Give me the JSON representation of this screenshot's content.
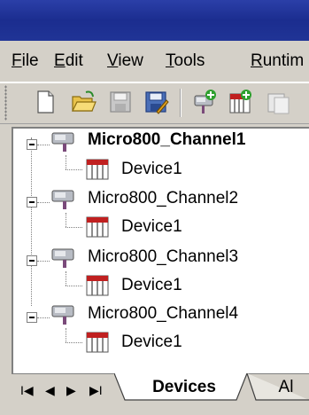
{
  "menu": {
    "file": {
      "u": "F",
      "rest": "ile"
    },
    "edit": {
      "u": "E",
      "rest": "dit"
    },
    "view": {
      "u": "V",
      "rest": "iew"
    },
    "tools": {
      "u": "T",
      "rest": "ools"
    },
    "runtime": {
      "u": "R",
      "rest": "untim"
    }
  },
  "toolbar": {
    "buttons": [
      "new-file-icon",
      "open-folder-icon",
      "save-icon",
      "save-as-icon",
      "new-channel-icon",
      "new-device-icon",
      "cut-icon"
    ]
  },
  "tree": {
    "channels": [
      {
        "label": "Micro800_Channel1",
        "bold": true,
        "device": "Device1"
      },
      {
        "label": "Micro800_Channel2",
        "bold": false,
        "device": "Device1"
      },
      {
        "label": "Micro800_Channel3",
        "bold": false,
        "device": "Device1"
      },
      {
        "label": "Micro800_Channel4",
        "bold": false,
        "device": "Device1"
      }
    ]
  },
  "tabs": {
    "nav": [
      "I◀",
      "◀",
      "▶",
      "▶I"
    ],
    "active": "Devices",
    "next": "Al"
  },
  "colors": {
    "titlebar": "#1b2d8f",
    "face": "#d4d0c8",
    "panel": "#ffffff"
  }
}
